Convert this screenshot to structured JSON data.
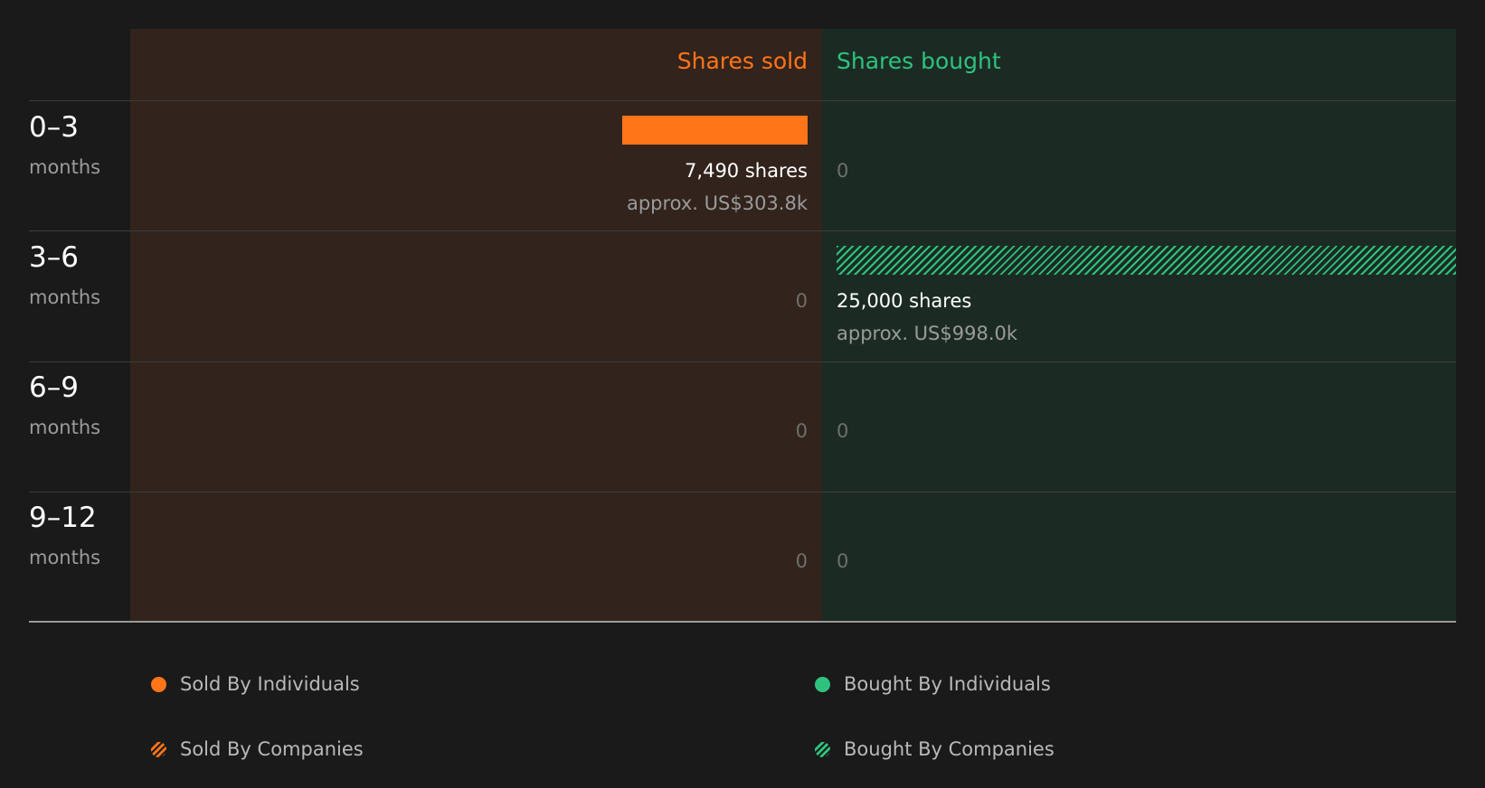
{
  "chart_data": {
    "type": "bar",
    "orientation": "horizontal-diverging",
    "columns": {
      "sold": "Shares sold",
      "bought": "Shares bought"
    },
    "categories": [
      {
        "range": "0–3",
        "unit": "months"
      },
      {
        "range": "3–6",
        "unit": "months"
      },
      {
        "range": "6–9",
        "unit": "months"
      },
      {
        "range": "9–12",
        "unit": "months"
      }
    ],
    "series": [
      {
        "name": "Sold By Individuals",
        "side": "sold",
        "pattern": "solid",
        "values": [
          7490,
          0,
          0,
          0
        ]
      },
      {
        "name": "Sold By Companies",
        "side": "sold",
        "pattern": "hatched",
        "values": [
          0,
          0,
          0,
          0
        ]
      },
      {
        "name": "Bought By Individuals",
        "side": "bought",
        "pattern": "solid",
        "values": [
          0,
          0,
          0,
          0
        ]
      },
      {
        "name": "Bought By Companies",
        "side": "bought",
        "pattern": "hatched",
        "values": [
          0,
          25000,
          0,
          0
        ]
      }
    ],
    "sold_labels": [
      {
        "shares": "7,490 shares",
        "approx": "approx. US$303.8k"
      },
      {
        "zero": "0"
      },
      {
        "zero": "0"
      },
      {
        "zero": "0"
      }
    ],
    "bought_labels": [
      {
        "zero": "0"
      },
      {
        "shares": "25,000 shares",
        "approx": "approx. US$998.0k"
      },
      {
        "zero": "0"
      },
      {
        "zero": "0"
      }
    ],
    "colors": {
      "sold": "#ff7518",
      "bought": "#2ec27e",
      "sold_panel": "#32231c",
      "bought_panel": "#1b2b24"
    },
    "legend": {
      "position": "bottom",
      "items": [
        {
          "label": "Sold By Individuals",
          "marker": "dot-solid-orange"
        },
        {
          "label": "Bought By Individuals",
          "marker": "dot-solid-green"
        },
        {
          "label": "Sold By Companies",
          "marker": "dot-hatched-orange"
        },
        {
          "label": "Bought By Companies",
          "marker": "dot-hatched-green"
        }
      ]
    }
  }
}
